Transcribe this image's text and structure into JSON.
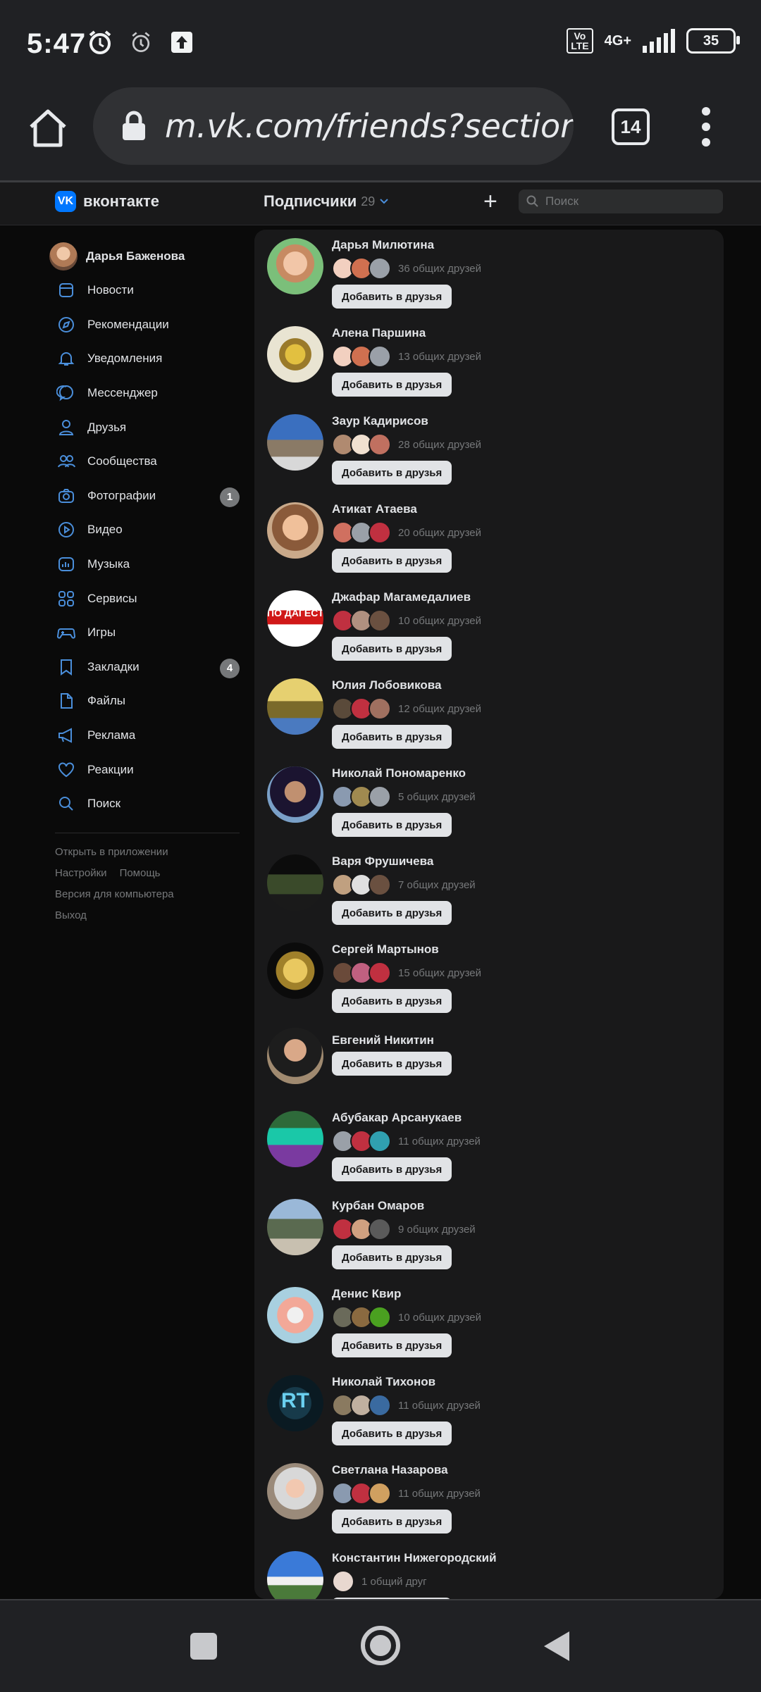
{
  "status_bar": {
    "time": "5:47",
    "network": "4G+",
    "volte": "Vo\nLTE",
    "battery": "35"
  },
  "browser": {
    "url": "m.vk.com/friends?section=",
    "tabs_count": "14"
  },
  "header": {
    "logo_text": "вконтакте",
    "title": "Подписчики",
    "count": "29",
    "search_placeholder": "Поиск"
  },
  "sidebar": {
    "profile_name": "Дарья Баженова",
    "items": [
      {
        "label": "Новости",
        "icon": "news-icon"
      },
      {
        "label": "Рекомендации",
        "icon": "compass-icon"
      },
      {
        "label": "Уведомления",
        "icon": "bell-icon"
      },
      {
        "label": "Мессенджер",
        "icon": "message-icon"
      },
      {
        "label": "Друзья",
        "icon": "user-icon"
      },
      {
        "label": "Сообщества",
        "icon": "users-icon"
      },
      {
        "label": "Фотографии",
        "icon": "camera-icon",
        "badge": "1"
      },
      {
        "label": "Видео",
        "icon": "play-icon"
      },
      {
        "label": "Музыка",
        "icon": "music-icon"
      },
      {
        "label": "Сервисы",
        "icon": "grid-icon"
      },
      {
        "label": "Игры",
        "icon": "gamepad-icon"
      },
      {
        "label": "Закладки",
        "icon": "bookmark-icon",
        "badge": "4"
      },
      {
        "label": "Файлы",
        "icon": "file-icon"
      },
      {
        "label": "Реклама",
        "icon": "megaphone-icon"
      },
      {
        "label": "Реакции",
        "icon": "heart-icon"
      },
      {
        "label": "Поиск",
        "icon": "search-icon"
      }
    ],
    "footer": {
      "open_app": "Открыть в приложении",
      "settings": "Настройки",
      "help": "Помощь",
      "desktop": "Версия для компьютера",
      "logout": "Выход"
    }
  },
  "add_button_label": "Добавить в друзья",
  "subscribers": [
    {
      "name": "Дарья Милютина",
      "mutual": "36 общих друзей"
    },
    {
      "name": "Алена Паршина",
      "mutual": "13 общих друзей"
    },
    {
      "name": "Заур Кадирисов",
      "mutual": "28 общих друзей"
    },
    {
      "name": "Атикат Атаева",
      "mutual": "20 общих друзей"
    },
    {
      "name": "Джафар Магамедалиев",
      "mutual": "10 общих друзей"
    },
    {
      "name": "Юлия Лобовикова",
      "mutual": "12 общих друзей"
    },
    {
      "name": "Николай Пономаренко",
      "mutual": "5 общих друзей"
    },
    {
      "name": "Варя Фрушичева",
      "mutual": "7 общих друзей"
    },
    {
      "name": "Сергей Мартынов",
      "mutual": "15 общих друзей"
    },
    {
      "name": "Евгений Никитин",
      "mutual": ""
    },
    {
      "name": "Абубакар Арсанукаев",
      "mutual": "11 общих друзей"
    },
    {
      "name": "Курбан Омаров",
      "mutual": "9 общих друзей"
    },
    {
      "name": "Денис Квир",
      "mutual": "10 общих друзей"
    },
    {
      "name": "Николай Тихонов",
      "mutual": "11 общих друзей"
    },
    {
      "name": "Светлана Назарова",
      "mutual": "11 общих друзей"
    },
    {
      "name": "Константин Нижегородский",
      "mutual": "1 общий друг"
    }
  ],
  "avatar_texts": {
    "dagestan": "ПО ДАГЕСТ",
    "rt": "RT"
  }
}
